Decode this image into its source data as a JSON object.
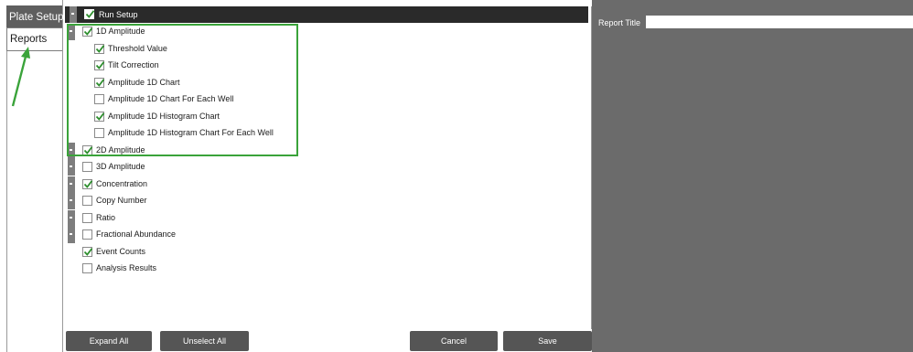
{
  "nav": {
    "plate_setup": "Plate Setup",
    "reports": "Reports"
  },
  "tree": {
    "root": {
      "label": "Run Setup",
      "checked": true
    },
    "rows": [
      {
        "label": "1D Amplitude",
        "checked": true,
        "level": 0,
        "expander": true
      },
      {
        "label": "Threshold Value",
        "checked": true,
        "level": 1,
        "expander": false
      },
      {
        "label": "Tilt Correction",
        "checked": true,
        "level": 1,
        "expander": false
      },
      {
        "label": "Amplitude 1D Chart",
        "checked": true,
        "level": 1,
        "expander": false
      },
      {
        "label": "Amplitude 1D Chart For Each Well",
        "checked": false,
        "level": 1,
        "expander": false
      },
      {
        "label": "Amplitude 1D Histogram Chart",
        "checked": true,
        "level": 1,
        "expander": false
      },
      {
        "label": "Amplitude 1D Histogram Chart For Each Well",
        "checked": false,
        "level": 1,
        "expander": false
      },
      {
        "label": "2D Amplitude",
        "checked": true,
        "level": 0,
        "expander": true
      },
      {
        "label": "3D Amplitude",
        "checked": false,
        "level": 0,
        "expander": true
      },
      {
        "label": "Concentration",
        "checked": true,
        "level": 0,
        "expander": true
      },
      {
        "label": "Copy Number",
        "checked": false,
        "level": 0,
        "expander": true
      },
      {
        "label": "Ratio",
        "checked": false,
        "level": 0,
        "expander": true
      },
      {
        "label": "Fractional Abundance",
        "checked": false,
        "level": 0,
        "expander": true
      },
      {
        "label": "Event Counts",
        "checked": true,
        "level": 0,
        "expander": false
      },
      {
        "label": "Analysis Results",
        "checked": false,
        "level": 0,
        "expander": false
      }
    ]
  },
  "toolbar": {
    "expand_all": "Expand All",
    "unselect_all": "Unselect All",
    "cancel": "Cancel",
    "save": "Save"
  },
  "report": {
    "title_label": "Report Title",
    "title_value": ""
  },
  "colors": {
    "highlight": "#3aa33a",
    "arrow": "#3aa33a",
    "dark_header": "#2a2a2a",
    "panel_gray": "#6b6b6b",
    "button_gray": "#555555"
  }
}
